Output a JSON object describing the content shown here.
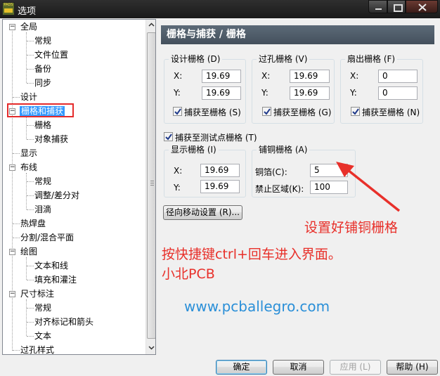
{
  "window": {
    "title": "选项",
    "app_badge": "PADS",
    "minimize_icon": "minimize-icon",
    "maximize_icon": "maximize-icon",
    "close_icon": "close-icon"
  },
  "tree": {
    "items": [
      {
        "label": "全局",
        "expander": "−"
      },
      {
        "label": "常规"
      },
      {
        "label": "文件位置"
      },
      {
        "label": "备份"
      },
      {
        "label": "同步"
      },
      {
        "label": "设计"
      },
      {
        "label": "栅格和捕获",
        "expander": "−",
        "selected": true
      },
      {
        "label": "栅格"
      },
      {
        "label": "对象捕获"
      },
      {
        "label": "显示"
      },
      {
        "label": "布线",
        "expander": "−"
      },
      {
        "label": "常规"
      },
      {
        "label": "调整/差分对"
      },
      {
        "label": "泪滴"
      },
      {
        "label": "热焊盘"
      },
      {
        "label": "分割/混合平面"
      },
      {
        "label": "绘图",
        "expander": "−"
      },
      {
        "label": "文本和线"
      },
      {
        "label": "填充和灌注"
      },
      {
        "label": "尺寸标注",
        "expander": "−"
      },
      {
        "label": "常规"
      },
      {
        "label": "对齐标记和箭头"
      },
      {
        "label": "文本"
      },
      {
        "label": "过孔样式"
      }
    ]
  },
  "panel": {
    "title": "栅格与捕获 / 栅格",
    "design_grid": {
      "title": "设计栅格 (D)",
      "x_label": "X:",
      "x_value": "19.69",
      "y_label": "Y:",
      "y_value": "19.69",
      "snap_label": "捕获至栅格 (S)",
      "snap_checked": true
    },
    "via_grid": {
      "title": "过孔栅格 (V)",
      "x_label": "X:",
      "x_value": "19.69",
      "y_label": "Y:",
      "y_value": "19.69",
      "snap_label": "捕获至栅格 (G)",
      "snap_checked": true
    },
    "fanout_grid": {
      "title": "扇出栅格 (F)",
      "x_label": "X:",
      "x_value": "0",
      "y_label": "Y:",
      "y_value": "0",
      "snap_label": "捕获至栅格 (N)",
      "snap_checked": true
    },
    "testpoint_snap": {
      "label": "捕获至测试点栅格 (T)",
      "checked": true
    },
    "display_grid": {
      "title": "显示栅格 (I)",
      "x_label": "X:",
      "x_value": "19.69",
      "y_label": "Y:",
      "y_value": "19.69"
    },
    "copper_grid": {
      "title": "铺铜栅格 (A)",
      "copper_label": "铜箔(C):",
      "copper_value": "5",
      "keepout_label": "禁止区域(K):",
      "keepout_value": "100"
    },
    "radial_move_button": "径向移动设置 (R)..."
  },
  "annotations": {
    "copper_note": "设置好铺铜栅格",
    "shortcut_note": "按快捷键ctrl+回车进入界面。",
    "author": "小北PCB",
    "website": "www.pcballegro.com"
  },
  "footer": {
    "ok": "确定",
    "cancel": "取消",
    "apply": "应用 (L)",
    "help": "帮助 (H)"
  },
  "colors": {
    "annotation_red": "#e8302a",
    "annotation_blue": "#2a8fd8",
    "selection": "#3399ff",
    "header": "#4f5b67"
  }
}
